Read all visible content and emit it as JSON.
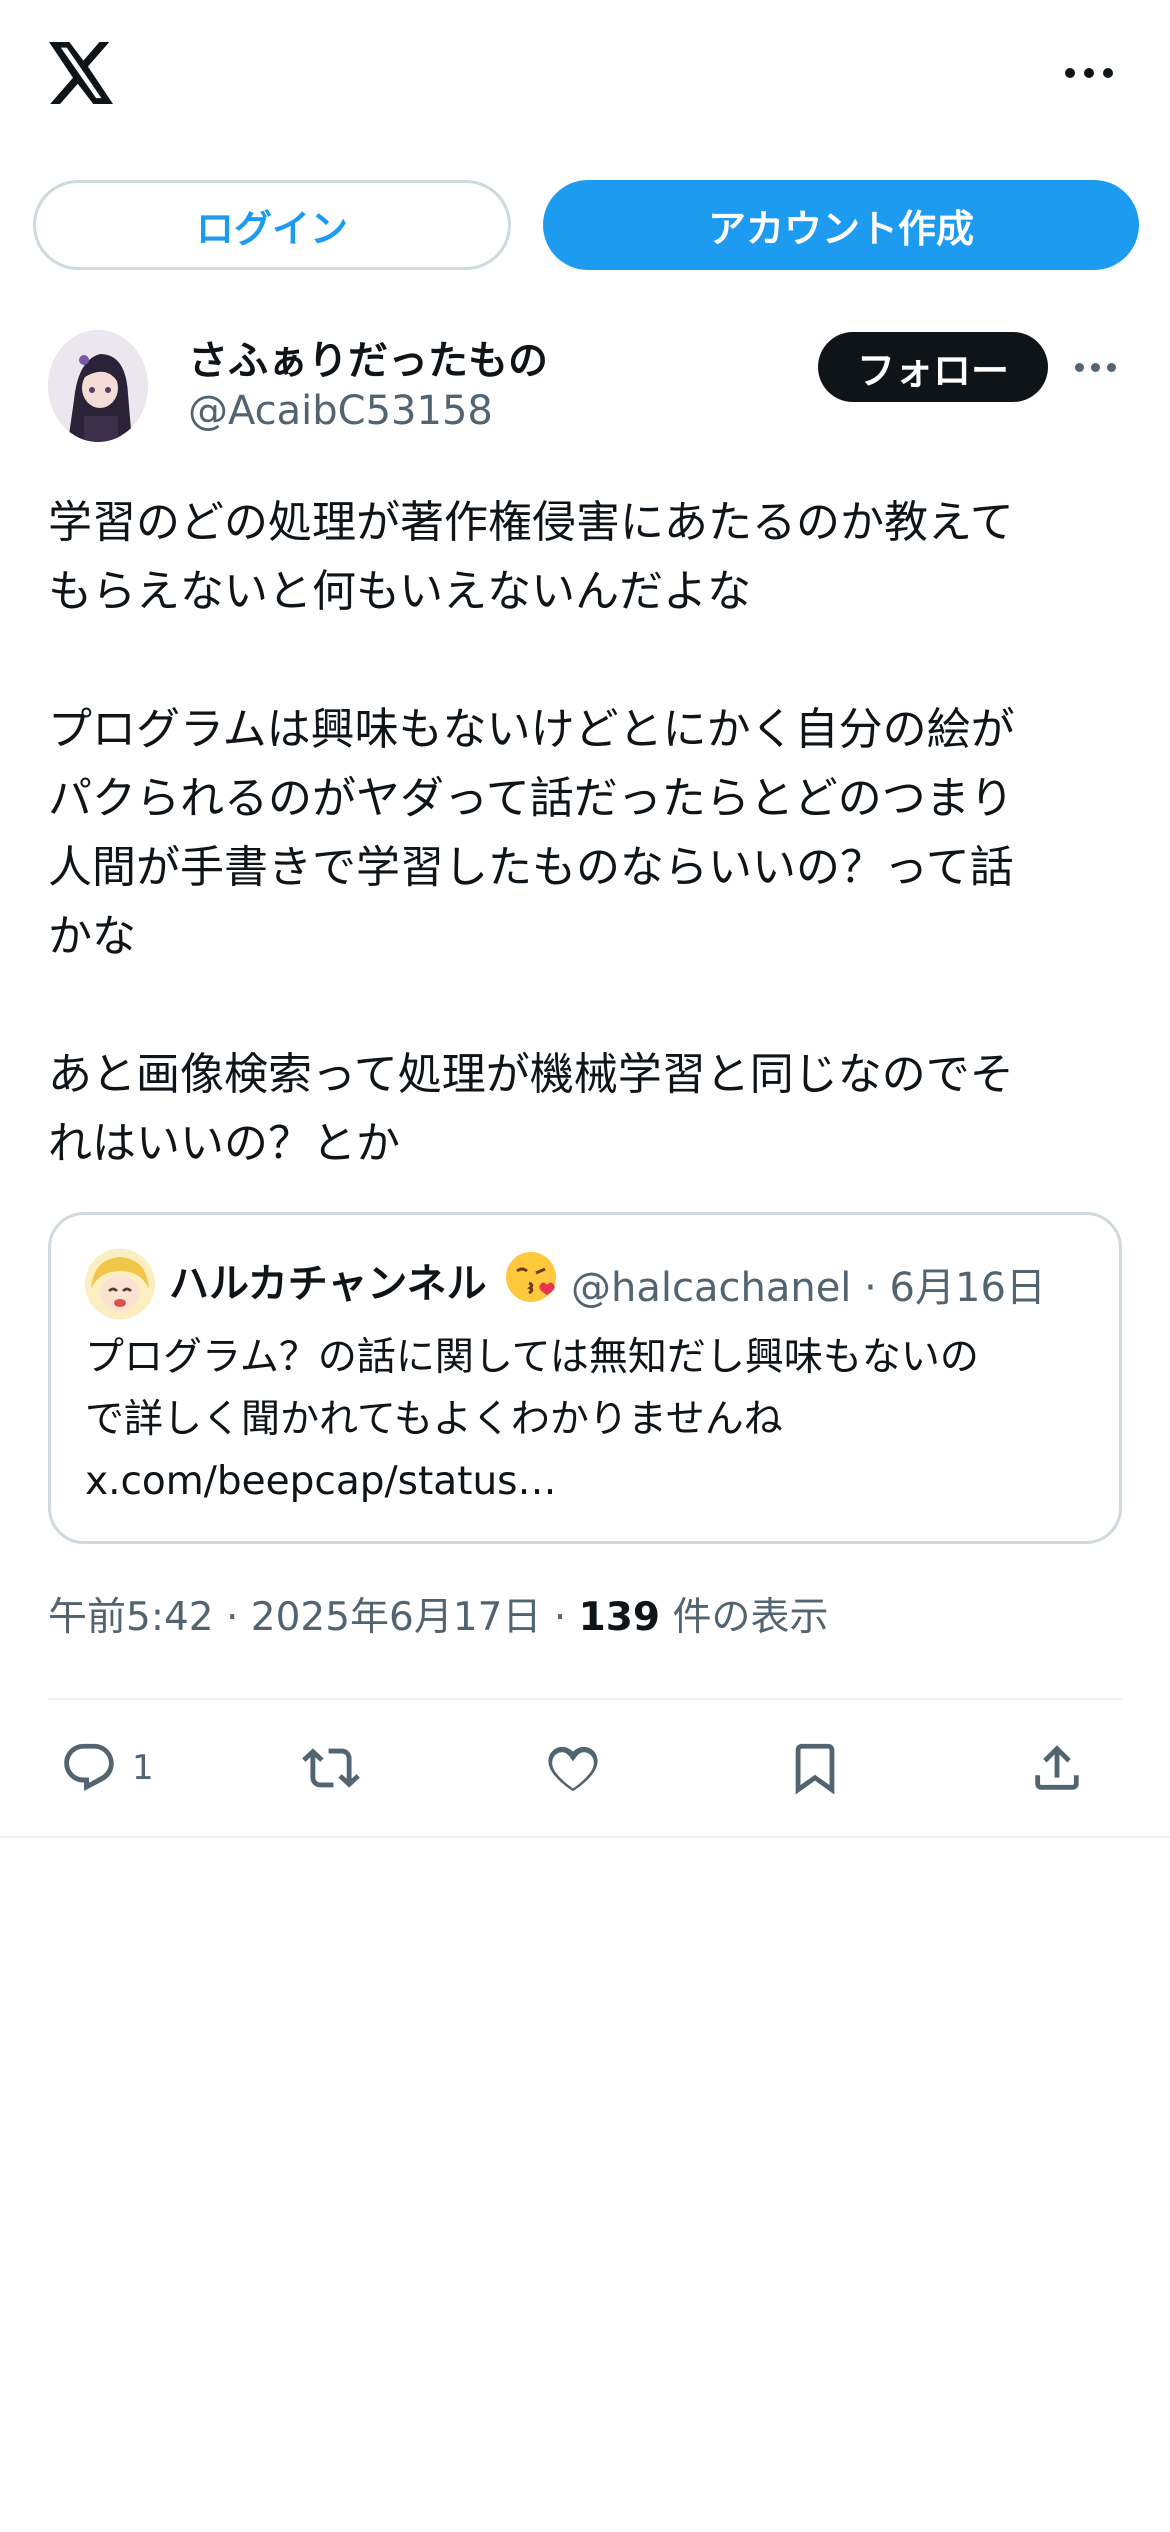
{
  "header": {
    "logo_icon": "x-logo-icon",
    "more_icon": "more-horizontal-icon"
  },
  "auth": {
    "login_label": "ログイン",
    "signup_label": "アカウント作成"
  },
  "post": {
    "author_name": "さふぁりだったもの",
    "author_handle": "@AcaibC53158",
    "follow_label": "フォロー",
    "text": "学習のどの処理が著作権侵害にあたるのか教えて\nもらえないと何もいえないんだよな\n\nプログラムは興味もないけどとにかく自分の絵が\nパクられるのがヤダって話だったらとどのつまり\n人間が手書きで学習したものならいいの？って話\nかな\n\nあと画像検索って処理が機械学習と同じなのでそ\nれはいいの？とか",
    "timestamp": "午前5:42 · 2025年6月17日 · ",
    "views_count": "139",
    "views_label": " 件の表示"
  },
  "quote": {
    "name": "ハルカチャンネル",
    "emoji_icon": "kissing-face-emoji-icon",
    "handle_date": "@halcachanel · 6月16日",
    "text": "プログラム？の話に関しては無知だし興味もないの\nで詳しく聞かれてもよくわかりませんね\nx.com/beepcap/status…"
  },
  "actions": {
    "reply_count": "1",
    "icons": [
      "reply-icon",
      "retweet-icon",
      "like-icon",
      "bookmark-icon",
      "share-icon"
    ]
  },
  "colors": {
    "accent": "#1d9bf0",
    "text": "#0f1419",
    "secondary": "#536471",
    "border": "#cfd9de"
  }
}
